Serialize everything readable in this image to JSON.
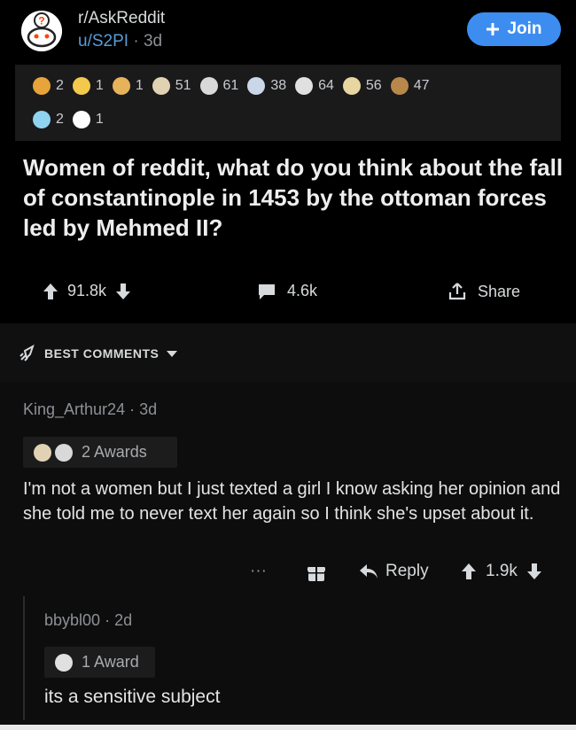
{
  "post": {
    "subreddit": "r/AskReddit",
    "author": "u/S2PI",
    "separator": "·",
    "age": "3d",
    "join_label": "Join",
    "title": "Women of reddit, what do you think about the fall of constantinople in 1453 by the ottoman forces led by Mehmed II?",
    "awards_row1": [
      {
        "icon": "rocket-like-award-icon",
        "count": "2",
        "color": "#e8a33a"
      },
      {
        "icon": "gold-crown-award-icon",
        "count": "1",
        "color": "#f2c94c"
      },
      {
        "icon": "hands-award-icon",
        "count": "1",
        "color": "#e6b35a"
      },
      {
        "icon": "wholesome-award-icon",
        "count": "51",
        "color": "#e0d2b3"
      },
      {
        "icon": "bravo-award-icon",
        "count": "61",
        "color": "#d9d9d9"
      },
      {
        "icon": "laughing-award-icon",
        "count": "38",
        "color": "#c9d7e8"
      },
      {
        "icon": "silver-award-icon",
        "count": "64",
        "color": "#e0e0e0"
      },
      {
        "icon": "face-award-icon",
        "count": "56",
        "color": "#e8d6a0"
      },
      {
        "icon": "poop-award-icon",
        "count": "47",
        "color": "#b8884a"
      }
    ],
    "awards_row2": [
      {
        "icon": "angel-award-icon",
        "count": "2",
        "color": "#8fd3f0"
      },
      {
        "icon": "snoo-award-icon",
        "count": "1",
        "color": "#ffffff"
      }
    ],
    "upvotes": "91.8k",
    "comments": "4.6k",
    "share_label": "Share"
  },
  "sort": {
    "label": "BEST COMMENTS"
  },
  "comment": {
    "author": "King_Arthur24",
    "separator": "·",
    "age": "3d",
    "awards_label": "2 Awards",
    "body": "I'm not a women but I just texted a girl I know asking her opinion and she told me to never text her again so I think she's upset about it.",
    "more": "···",
    "reply_label": "Reply",
    "votes": "1.9k"
  },
  "reply": {
    "author": "bbybl00",
    "separator": "·",
    "age": "2d",
    "awards_label": "1 Award",
    "body": "its a sensitive subject"
  }
}
